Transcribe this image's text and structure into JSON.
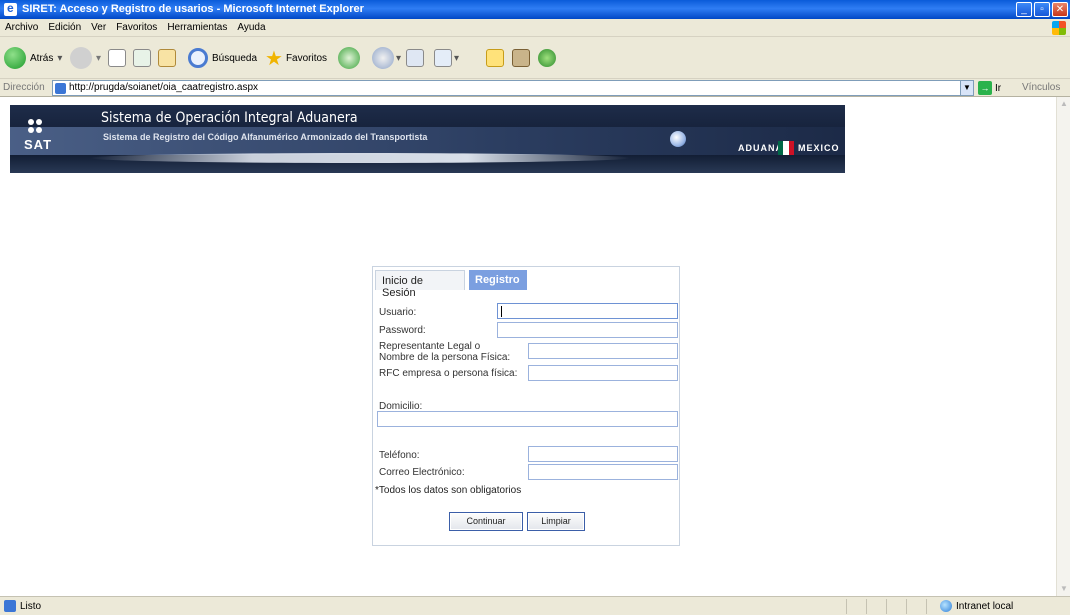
{
  "window": {
    "title": "SIRET: Acceso y Registro de usarios - Microsoft Internet Explorer",
    "buttons": [
      "_",
      "▫",
      "✕"
    ]
  },
  "menu": [
    "Archivo",
    "Edición",
    "Ver",
    "Favoritos",
    "Herramientas",
    "Ayuda"
  ],
  "toolbar": {
    "back": "Atrás",
    "search": "Búsqueda",
    "favorites": "Favoritos"
  },
  "address": {
    "label": "Dirección",
    "url": "http://prugda/soianet/oia_caatregistro.aspx",
    "go": "Ir",
    "links": "Vínculos"
  },
  "banner": {
    "title": "Sistema de Operación Integral Aduanera",
    "subtitle": "Sistema de Registro del Código Alfanumérico Armonizado del Transportista",
    "sat": "SAT",
    "aduana": "ADUANA",
    "mexico": "MEXICO",
    "flag_colors": [
      "#006847",
      "#ffffff",
      "#ce1126"
    ]
  },
  "form": {
    "tabs": [
      "Inicio de Sesión",
      "Registro"
    ],
    "active_tab": "Registro",
    "fields": {
      "usuario": {
        "label": "Usuario:",
        "value": ""
      },
      "password": {
        "label": "Password:",
        "value": ""
      },
      "representante_line1": "Representante Legal o",
      "representante_line2": "Nombre de la persona Física:",
      "representante": {
        "value": ""
      },
      "rfc": {
        "label": "RFC empresa o persona física:",
        "value": ""
      },
      "domicilio": {
        "label": "Domicilio:",
        "value": ""
      },
      "telefono": {
        "label": "Teléfono:",
        "value": ""
      },
      "correo": {
        "label": "Correo Electrónico:",
        "value": ""
      }
    },
    "note": "*Todos los datos son obligatorios",
    "buttons": {
      "continue": "Continuar",
      "clear": "Limpiar"
    },
    "accent": "#7b9fe0"
  },
  "status": {
    "text": "Listo",
    "zone": "Intranet local"
  }
}
